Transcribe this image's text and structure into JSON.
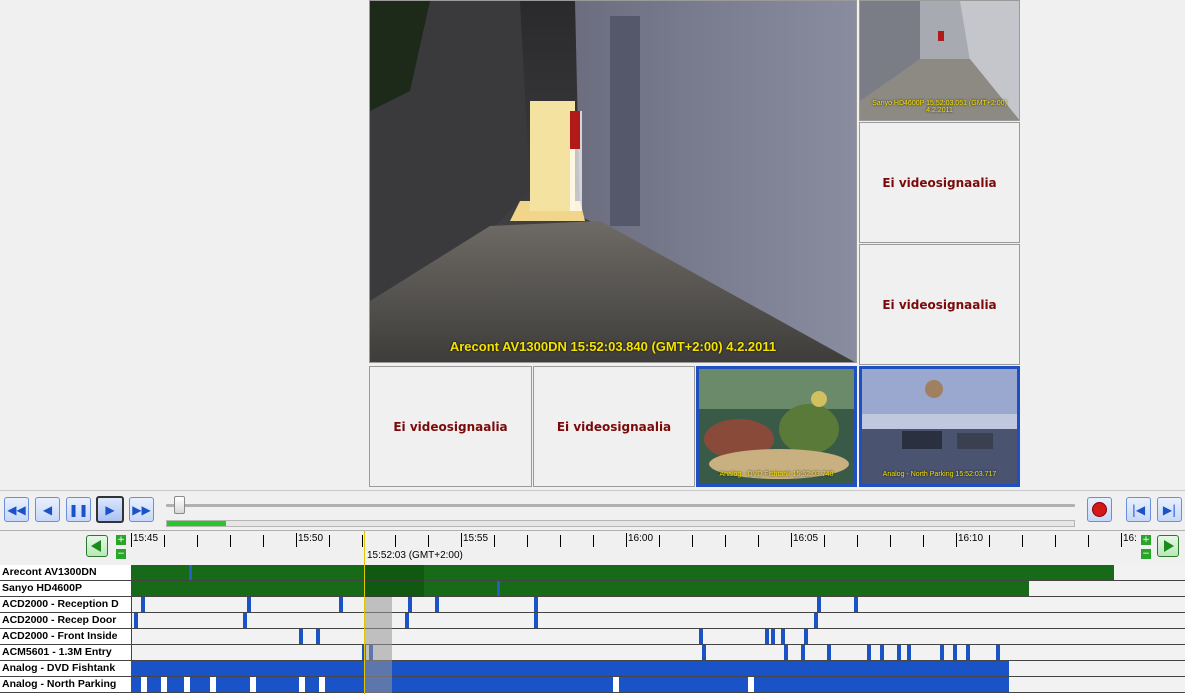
{
  "cameras": {
    "main": {
      "osd": "Arecont AV1300DN 15:52:03.840 (GMT+2:00) 4.2.2011"
    },
    "top_right": {
      "osd": "Sanyo HD4600P 15:52:03.051 (GMT+2:00) 4.2.2011"
    },
    "no_signal_text": "Ei videosignaalia",
    "fishtank": {
      "osd": "Analog - DVD Fishtank 15:52:03.748"
    },
    "parking": {
      "osd": "Analog - North Parking 15:52:03.717"
    }
  },
  "playback": {
    "progress_fraction": 0.065,
    "slider_fraction": 0.0
  },
  "timeline": {
    "ticks": [
      "15:45",
      "15:50",
      "15:55",
      "16:00",
      "16:05",
      "16:10",
      "16:"
    ],
    "cursor_label": "15:52:03 (GMT+2:00)",
    "cursor_minutes": 7.05,
    "visible_range_minutes": [
      0,
      30
    ],
    "rows": [
      {
        "label": "Arecont AV1300DN",
        "type": "continuous",
        "end": 29.8
      },
      {
        "label": "Sanyo HD4600P",
        "type": "continuous",
        "end": 27.2
      },
      {
        "label": "ACD2000 - Reception D",
        "type": "events",
        "events": [
          0.3,
          3.5,
          6.3,
          8.4,
          9.2,
          12.2,
          20.8,
          21.9
        ]
      },
      {
        "label": "ACD2000 - Recep Door",
        "type": "events",
        "events": [
          0.1,
          3.4,
          8.3,
          12.2,
          20.7
        ]
      },
      {
        "label": "ACD2000 - Front Inside",
        "type": "events",
        "events": [
          5.1,
          5.6,
          17.2,
          19.2,
          19.4,
          19.7,
          20.4
        ]
      },
      {
        "label": "ACM5601 - 1.3M Entry",
        "type": "events",
        "events": [
          7.0,
          7.2,
          17.3,
          19.8,
          20.3,
          21.1,
          22.3,
          22.7,
          23.2,
          23.5,
          24.5,
          24.9,
          25.3,
          26.2
        ]
      },
      {
        "label": "Analog - DVD Fishtank",
        "type": "continuous_blue",
        "end": 26.6
      },
      {
        "label": "Analog - North Parking",
        "type": "continuous_blue_gaps",
        "end": 26.6
      }
    ]
  }
}
